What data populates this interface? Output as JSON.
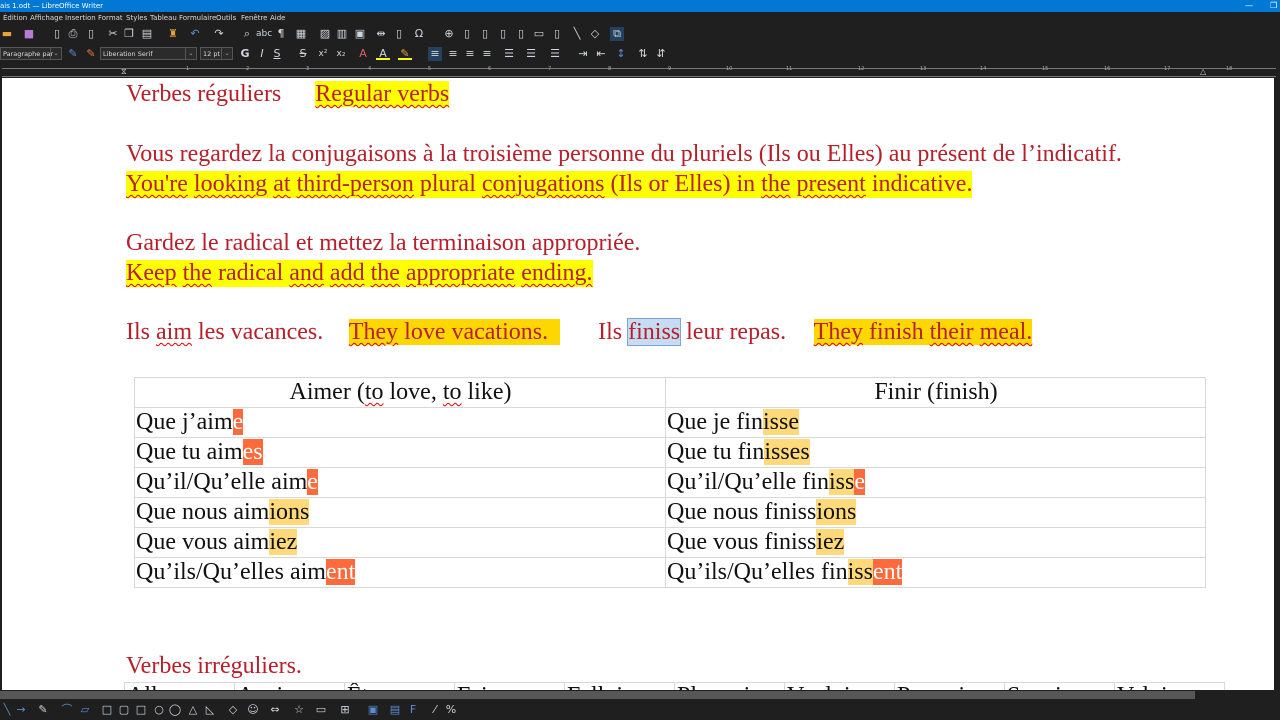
{
  "window": {
    "title": "ais 1.odt — LibreOffice Writer",
    "minimize": "—",
    "restore": "❐"
  },
  "menu": [
    "Édition",
    "Affichage",
    "Insertion",
    "Format",
    "Styles",
    "Tableau",
    "Formulaire",
    "Outils",
    "Fenêtre",
    "Aide"
  ],
  "formatting": {
    "paragraph_style": "Paragraphe par défaut",
    "font_name": "Liberation Serif",
    "font_size": "12 pt",
    "bold": "G",
    "italic": "I",
    "underline": "S",
    "strike": "S"
  },
  "ruler": {
    "labels": [
      "1",
      "2",
      "3",
      "4",
      "5",
      "6",
      "7",
      "8",
      "9",
      "10",
      "11",
      "12",
      "13",
      "14",
      "15",
      "16",
      "17",
      "18"
    ]
  },
  "document": {
    "heading_fr": "Verbes réguliers",
    "heading_en": "Regular verbs",
    "p1_fr": "Vous regardez la conjugaisons à la troisième personne du pluriels (Ils ou Elles) au présent de l’indicatif.",
    "p1_en": {
      "w1": "You're",
      "w2": "looking",
      "w3": "at",
      "w4": "third-person",
      "w5": "plural",
      "w6": "conjugations",
      "w7": "(Ils or Elles) in",
      "w8": "the",
      "w9": "present",
      "w10": "indicative."
    },
    "p2_fr": "Gardez le radical et mettez la terminaison appropriée.",
    "p2_en": {
      "w1": "Keep",
      "w2": "the",
      "w3": "radical",
      "w4": "and",
      "w5": "add",
      "w6": "the",
      "w7": "appropriate",
      "w8": "ending."
    },
    "ex1_fr_a": "Ils ",
    "ex1_fr_b": "aim",
    "ex1_fr_c": " les vacances.",
    "ex1_en_a": "They",
    "ex1_en_b": " love vacations.",
    "ex2_fr_a": "Ils ",
    "ex2_fr_sel": "finiss",
    "ex2_fr_c": " leur repas.",
    "ex2_en_a": "They",
    "ex2_en_b": " finish ",
    "ex2_en_c": "their",
    "ex2_en_d": " ",
    "ex2_en_e": "meal.",
    "irregular_heading": "Verbes irréguliers."
  },
  "table": {
    "header_left": {
      "a": "Aimer  (",
      "b": "to",
      "c": " love, ",
      "d": "to",
      "e": " like)"
    },
    "header_right": "Finir  (finish)",
    "rows": [
      {
        "l_stem": "Que j’aim",
        "l_end1": "e",
        "l_end2": "",
        "r_stem": "Que je fin",
        "r_end2": "isse",
        "r_end1": ""
      },
      {
        "l_stem": "Que tu aim",
        "l_end1": "es",
        "l_end2": "",
        "r_stem": "Que tu fin",
        "r_end2": "isses",
        "r_end1": ""
      },
      {
        "l_stem": "Qu’il/Qu’elle aim",
        "l_end1": "e",
        "l_end2": "",
        "r_stem": "Qu’il/Qu’elle fin",
        "r_end2": "iss",
        "r_end1": "e"
      },
      {
        "l_stem": "Que nous aim",
        "l_end1": "",
        "l_end2": "ions",
        "r_stem": "Que nous finiss",
        "r_end2": "ions",
        "r_end1": ""
      },
      {
        "l_stem": "Que vous aim",
        "l_end1": "",
        "l_end2": "iez",
        "r_stem": "Que vous finiss",
        "r_end2": "iez",
        "r_end1": ""
      },
      {
        "l_stem": "Qu’ils/Qu’elles aim",
        "l_end1": "ent",
        "l_end2": "",
        "r_stem": "Qu’ils/Qu’elles fin",
        "r_end2": "iss",
        "r_end1": "ent"
      }
    ]
  },
  "irregular_table": {
    "headers": [
      "Aller",
      "Avoir",
      "Être",
      "Faire",
      "Falloir",
      "Pleuvoir",
      "Vouloir",
      "Pouvoir",
      "Savoir",
      "Valoir"
    ]
  },
  "colors": {
    "title_bar": "#0078d4",
    "doc_text": "#b7202a",
    "highlight_yellow": "#ffff00",
    "ending_orange": "#ff6a3d",
    "ending_light": "#ffd97a"
  }
}
